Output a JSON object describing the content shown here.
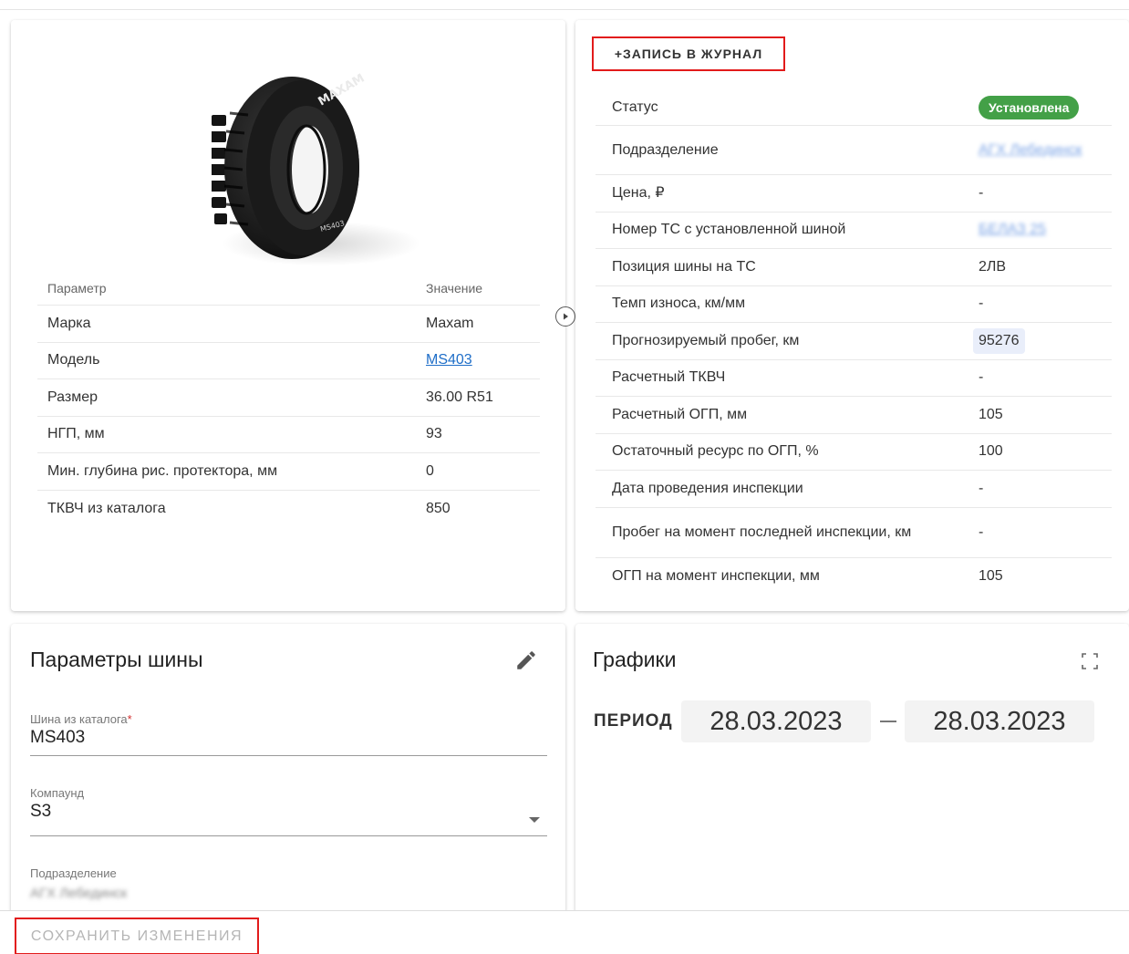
{
  "tire_card": {
    "table_header": {
      "param": "Параметр",
      "value": "Значение"
    },
    "rows": [
      {
        "param": "Марка",
        "value": "Maxam"
      },
      {
        "param": "Модель",
        "value": "MS403"
      },
      {
        "param": "Размер",
        "value": "36.00 R51"
      },
      {
        "param": "НГП, мм",
        "value": "93"
      },
      {
        "param": "Мин. глубина рис. протектора, мм",
        "value": "0"
      },
      {
        "param": "ТКВЧ из каталога",
        "value": "850"
      }
    ],
    "tire_brand_text": "MAXAM",
    "tire_model_text": "MS403"
  },
  "journal_card": {
    "add_entry_label": "+ЗАПИСЬ В ЖУРНАЛ",
    "rows": [
      {
        "label": "Статус",
        "value": "Установлена"
      },
      {
        "label": "Подразделение",
        "value": "АГХ Лебединск"
      },
      {
        "label": "Цена, ₽",
        "value": "-"
      },
      {
        "label": "Номер ТС с установленной шиной",
        "value": "БЕЛАЗ 25"
      },
      {
        "label": "Позиция шины на ТС",
        "value": "2ЛВ"
      },
      {
        "label": "Темп износа, км/мм",
        "value": "-"
      },
      {
        "label": "Прогнозируемый пробег, км",
        "value": "95276"
      },
      {
        "label": "Расчетный ТКВЧ",
        "value": "-"
      },
      {
        "label": "Расчетный ОГП, мм",
        "value": "105"
      },
      {
        "label": "Остаточный ресурс по ОГП, %",
        "value": "100"
      },
      {
        "label": "Дата проведения инспекции",
        "value": "-"
      },
      {
        "label": "Пробег на момент последней инспекции, км",
        "value": "-"
      },
      {
        "label": "ОГП на момент инспекции, мм",
        "value": "105"
      }
    ],
    "colors": {
      "status_badge": "#43a047",
      "highlight": "#e9eefa"
    }
  },
  "params_card": {
    "title": "Параметры шины",
    "fields": {
      "catalog_tire": {
        "label": "Шина из каталога",
        "required_mark": "*",
        "value": "MS403"
      },
      "compound": {
        "label": "Компаунд",
        "value": "S3"
      },
      "division": {
        "label": "Подразделение",
        "value": "АГХ Лебединск"
      }
    }
  },
  "graphs_card": {
    "title": "Графики",
    "period_label": "ПЕРИОД",
    "date_from": "28.03.2023",
    "date_to": "28.03.2023"
  },
  "bottom_bar": {
    "save_label": "СОХРАНИТЬ ИЗМЕНЕНИЯ"
  },
  "colors": {
    "highlight_border": "#e21b1b",
    "link": "#1e6ec8"
  }
}
